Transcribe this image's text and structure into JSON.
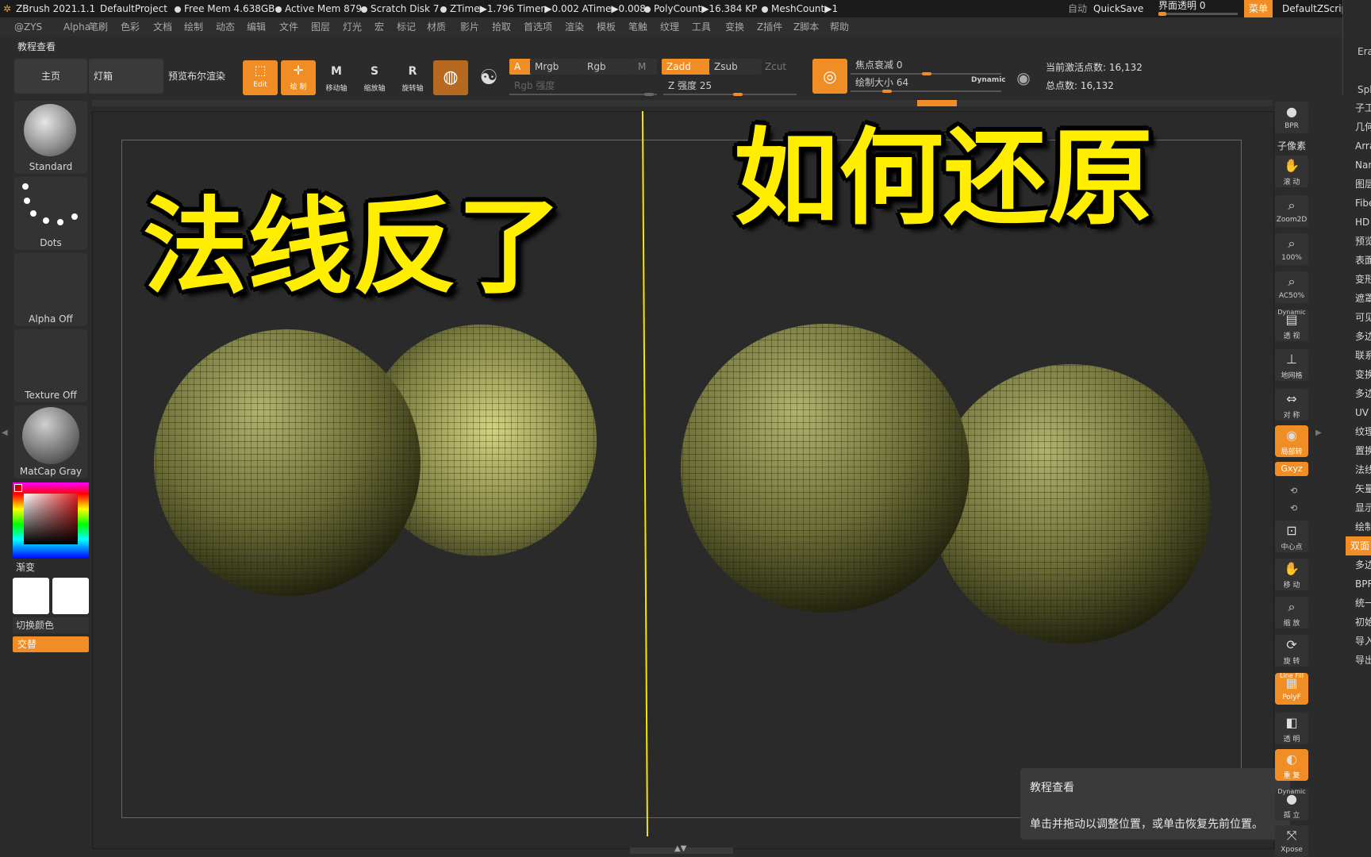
{
  "titlebar": {
    "app": "ZBrush 2021.1.1",
    "project": "DefaultProject",
    "free_mem": "Free Mem 4.638GB",
    "active_mem": "Active Mem 879",
    "scratch": "Scratch Disk 7",
    "ztime": "ZTime▶1.796 Timer▶0.002 ATime▶0.008",
    "polycount": "PolyCount▶16.384 KP",
    "meshcount": "MeshCount▶1",
    "auto": "自动",
    "quicksave": "QuickSave",
    "transparency": "界面透明 0",
    "menu": "菜单",
    "script": "DefaultZScript"
  },
  "menubar": [
    "@ZYS",
    "Alpha",
    "笔刷",
    "色彩",
    "文档",
    "绘制",
    "动态",
    "编辑",
    "文件",
    "图层",
    "灯光",
    "宏",
    "标记",
    "材质",
    "影片",
    "拾取",
    "首选项",
    "渲染",
    "模板",
    "笔触",
    "纹理",
    "工具",
    "变换",
    "Z插件",
    "Z脚本",
    "帮助"
  ],
  "tutorial_label": "教程查看",
  "toolbar": {
    "home": "主页",
    "lightbox": "灯箱",
    "bool_render": "预览布尔渲染",
    "edit": "Edit",
    "draw": "绘 制",
    "move": "移动轴",
    "scale": "缩放轴",
    "rotate": "旋转轴",
    "a": "A",
    "mrgb": "Mrgb",
    "rgb": "Rgb",
    "m": "M",
    "zadd": "Zadd",
    "zsub": "Zsub",
    "zcut": "Zcut",
    "rgb_intensity": "Rgb 强度",
    "z_intensity": "Z 强度 25",
    "focal_shift": "焦点衰减 0",
    "draw_size": "绘制大小 64",
    "dynamic": "Dynamic",
    "active_points": "当前激活点数: 16,132",
    "total_points": "总点数: 16,132"
  },
  "left": {
    "standard": "Standard",
    "dots": "Dots",
    "alpha": "Alpha Off",
    "texture": "Texture Off",
    "matcap": "MatCap Gray",
    "gradient": "渐变",
    "switch_color": "切换颜色",
    "alternate": "交替"
  },
  "right_tools": {
    "bpr": "BPR",
    "subpixel": "子像素",
    "scroll": "滚 动",
    "zoom2d": "Zoom2D",
    "z100": "100%",
    "ac50": "AC50%",
    "persp_top": "Dynamic",
    "persp": "透 视",
    "floor": "地网格",
    "sym": "对 称",
    "local": "局部转",
    "xyz": "Gxyz",
    "center": "中心点",
    "move": "移 动",
    "scale": "缩 放",
    "rotate": "旋 转",
    "polyf_top": "Line Fill",
    "polyf": "PolyF",
    "transp": "透 明",
    "ghost": "重 复",
    "solo_top": "Dynamic",
    "solo": "孤 立",
    "xpose": "Xpose"
  },
  "far_right": [
    "子工",
    "几何",
    "Arra",
    "Nar",
    "图层",
    "Fibe",
    "HD",
    "预览",
    "表面",
    "变形",
    "遮罩",
    "可见",
    "多边",
    "联系",
    "变换",
    "多边",
    "UV",
    "纹理",
    "置换",
    "法线",
    "矢量",
    "显示",
    "绘制",
    "双面",
    "多边",
    "BPR",
    "统一",
    "初始",
    "导入",
    "导出"
  ],
  "far_right_top": {
    "era": "Era",
    "spl": "Spl"
  },
  "overlay": {
    "left_title": "法线反了",
    "right_title": "如何还原"
  },
  "tooltip": {
    "title": "教程查看",
    "body": "单击并拖动以调整位置，或单击恢复先前位置。"
  },
  "colors": {
    "accent": "#f08d24",
    "title_yellow": "#ffee00",
    "mesh": "#7d7f3c"
  }
}
